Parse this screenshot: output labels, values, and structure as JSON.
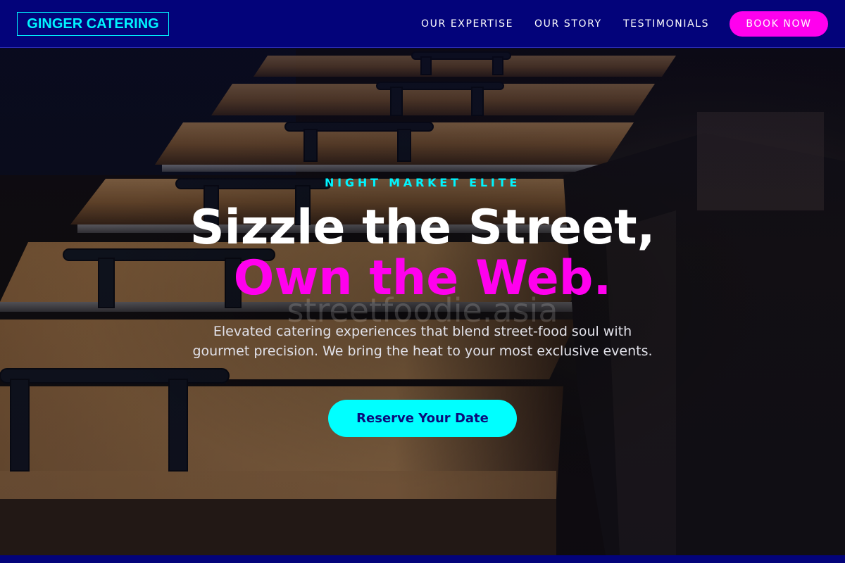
{
  "brand": {
    "logo_text": "GINGER CATERING"
  },
  "nav": {
    "items": [
      {
        "label": "OUR EXPERTISE"
      },
      {
        "label": "OUR STORY"
      },
      {
        "label": "TESTIMONIALS"
      }
    ],
    "book_label": "BOOK NOW"
  },
  "hero": {
    "eyebrow": "NIGHT MARKET ELITE",
    "headline_line1": "Sizzle the Street,",
    "headline_line2": "Own the Web.",
    "watermark": "streetfoodie.asia",
    "subtitle": "Elevated catering experiences that blend street-food soul with gourmet precision. We bring the heat to your most exclusive events.",
    "cta_label": "Reserve Your Date"
  },
  "colors": {
    "header_bg": "#03037a",
    "accent_cyan": "#00f5ff",
    "accent_magenta": "#ff00ee",
    "cta_text": "#0b0b7a"
  }
}
